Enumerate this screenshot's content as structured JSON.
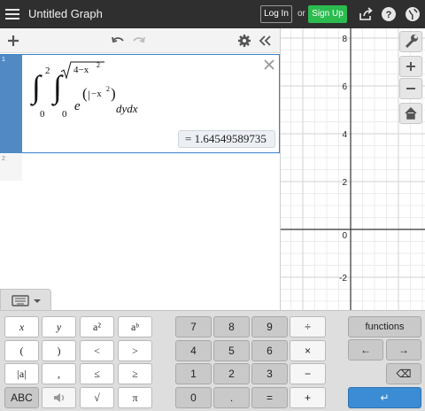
{
  "app": {
    "title": "Untitled Graph",
    "login_label": "Log In",
    "or_label": "or",
    "signup_label": "Sign Up"
  },
  "expressions": [
    {
      "index": "1",
      "formula": {
        "int1_upper": "2",
        "int1_lower": "0",
        "int2_upper": "√4−x²",
        "int2_upper_radicand": "4−x",
        "int2_upper_exp": "2",
        "int2_lower": "0",
        "base": "e",
        "exponent": "(|−x²)",
        "exponent_inner": "−x",
        "exponent_power": "2",
        "differentials": "dydx"
      },
      "result": "= 1.64549589735"
    },
    {
      "index": "2",
      "formula": "",
      "result": ""
    }
  ],
  "graph": {
    "y_ticks": [
      "8",
      "6",
      "4",
      "2",
      "0",
      "-2"
    ],
    "grid": true
  },
  "keypad": {
    "group1": [
      [
        "x",
        "y",
        "a²",
        "aᵇ"
      ],
      [
        "(",
        ")",
        "<",
        ">"
      ],
      [
        "|a|",
        ",",
        "≤",
        "≥"
      ],
      [
        "ABC",
        "",
        "√",
        "π"
      ]
    ],
    "group2": [
      [
        "7",
        "8",
        "9",
        "÷"
      ],
      [
        "4",
        "5",
        "6",
        "×"
      ],
      [
        "1",
        "2",
        "3",
        "−"
      ],
      [
        "0",
        ".",
        "=",
        "+"
      ]
    ],
    "functions_label": "functions",
    "left_arrow": "←",
    "right_arrow": "→",
    "backspace": "⌫",
    "enter": "↵"
  },
  "colors": {
    "topbar": "#2f2f2f",
    "signup": "#2bbb4f",
    "accent": "#5189c5",
    "enter_key": "#3b8cd4"
  }
}
